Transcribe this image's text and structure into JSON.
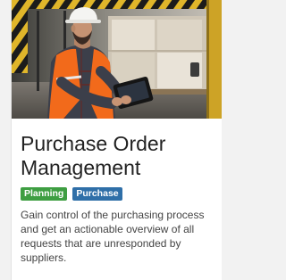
{
  "card": {
    "image_alt": "warehouse-worker-with-tablet",
    "title": "Purchase Order Management",
    "tags": [
      "Planning",
      "Purchase"
    ],
    "tag_colors": {
      "Planning": "#3e9e42",
      "Purchase": "#2f6fa8"
    },
    "description": "Gain control of the purchasing process and get an actionable overview of all requests that are unresponded by suppliers."
  }
}
